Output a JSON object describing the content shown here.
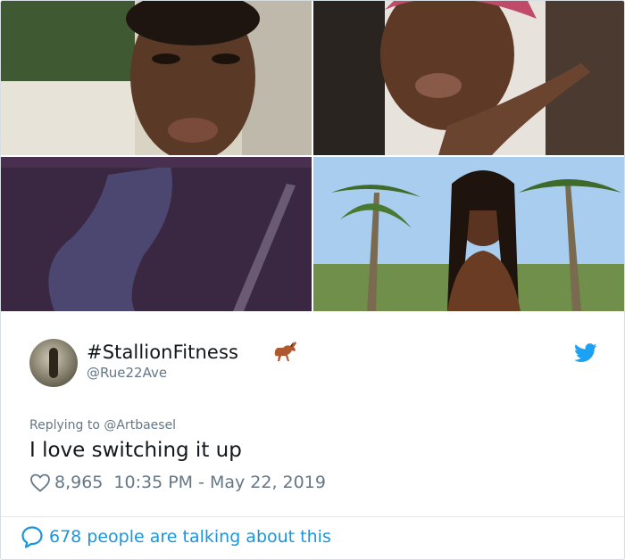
{
  "photos": [
    {
      "id": "photo-1",
      "colors": [
        "#cfc8b8",
        "#6b4a35",
        "#2a1c14"
      ]
    },
    {
      "id": "photo-2",
      "colors": [
        "#3a2a22",
        "#8a5a3c",
        "#e9e3de"
      ]
    },
    {
      "id": "photo-3",
      "colors": [
        "#3b2940",
        "#5a3f6a",
        "#2a2036"
      ]
    },
    {
      "id": "photo-4",
      "colors": [
        "#9fc6ea",
        "#4f7a3a",
        "#3b2518"
      ]
    }
  ],
  "tweet": {
    "display_name": "#StallionFitness",
    "handle": "@Rue22Ave",
    "replying_to": "Replying to @Artbaesel",
    "text": "I love switching it up",
    "likes": "8,965",
    "timestamp": "10:35 PM - May 22, 2019"
  },
  "footer": {
    "talking": "678 people are talking about this"
  },
  "colors": {
    "link_blue": "#1b95e0",
    "muted": "#657786",
    "text": "#14171a"
  }
}
